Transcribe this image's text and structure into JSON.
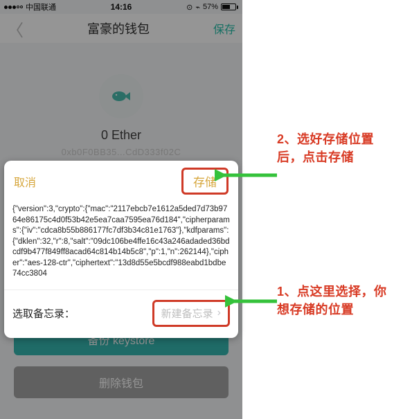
{
  "status": {
    "carrier": "中国联通",
    "time": "14:16",
    "battery_pct": "57%"
  },
  "nav": {
    "title": "富豪的钱包",
    "save": "保存"
  },
  "wallet": {
    "balance": "0 Ether",
    "address": "0xb0F0BB35...CdD333f02C"
  },
  "buttons": {
    "backup": "备份 keystore",
    "delete": "删除钱包"
  },
  "sheet": {
    "cancel": "取消",
    "store": "存储",
    "json": "{\"version\":3,\"crypto\":{\"mac\":\"2117ebcb7e1612a5ded7d73b9764e86175c4d0f53b42e5ea7caa7595ea76d184\",\"cipherparams\":{\"iv\":\"cdca8b55b886177fc7df3b34c81e1763\"},\"kdfparams\":{\"dklen\":32,\"r\":8,\"salt\":\"09dc106be4ffe16c43a246adaded36bdcdf9b477f849ff8acad64c814b14b5c8\",\"p\":1,\"n\":262144},\"cipher\":\"aes-128-ctr\",\"ciphertext\":\"13d8d55e5bcdf988eabd1bdbe74cc3804",
    "memo_label": "选取备忘录：",
    "memo_placeholder": "新建备忘录"
  },
  "annotations": {
    "step2": "2、选好存储位置后，点击存储",
    "step1": "1、点这里选择，你想存储的位置"
  }
}
